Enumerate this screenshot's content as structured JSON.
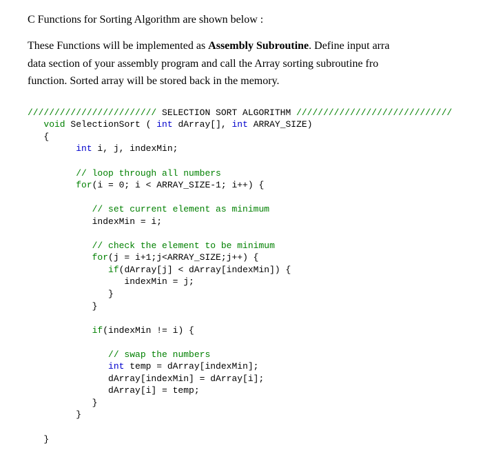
{
  "heading": "C Functions for Sorting Algorithm are shown below :",
  "para_parts": {
    "p1": "These Functions will be implemented as ",
    "bold": "Assembly Subroutine",
    "p2": ". Define input arra",
    "line2": "data section of your assembly program and call the Array sorting subroutine fro",
    "line3": "function. Sorted array will be stored back in the memory."
  },
  "code": {
    "l01a": "////////////////////////",
    "l01b": " SELECTION SORT ALGORITHM ",
    "l01c": "/////////////////////////////",
    "l02_indent": "   ",
    "l02_void": "void",
    "l02_name": " SelectionSort ( ",
    "l02_int1": "int",
    "l02_arr": " dArray[], ",
    "l02_int2": "int",
    "l02_arrsize": " ARRAY_SIZE)",
    "l03": "   {",
    "l04_indent": "         ",
    "l04_int": "int",
    "l04_rest": " i, j, indexMin;",
    "l05": "",
    "l06_indent": "         ",
    "l06_cm": "// loop through all numbers",
    "l07_indent": "         ",
    "l07_for": "for",
    "l07_rest": "(i = 0; i < ARRAY_SIZE-1; i++) {",
    "l08": "",
    "l09_indent": "            ",
    "l09_cm": "// set current element as minimum",
    "l10": "            indexMin = i;",
    "l11": "",
    "l12_indent": "            ",
    "l12_cm": "// check the element to be minimum",
    "l13_indent": "            ",
    "l13_for": "for",
    "l13_rest": "(j = i+1;j<ARRAY_SIZE;j++) {",
    "l14_indent": "               ",
    "l14_if": "if",
    "l14_rest": "(dArray[j] < dArray[indexMin]) {",
    "l15": "                  indexMin = j;",
    "l16": "               }",
    "l17": "            }",
    "l18": "",
    "l19_indent": "            ",
    "l19_if": "if",
    "l19_rest": "(indexMin != i) {",
    "l20": "",
    "l21_indent": "               ",
    "l21_cm": "// swap the numbers",
    "l22_indent": "               ",
    "l22_int": "int",
    "l22_rest": " temp = dArray[indexMin];",
    "l23": "               dArray[indexMin] = dArray[i];",
    "l24": "               dArray[i] = temp;",
    "l25": "            }",
    "l26": "         }",
    "l27": "",
    "l28": "   }"
  }
}
